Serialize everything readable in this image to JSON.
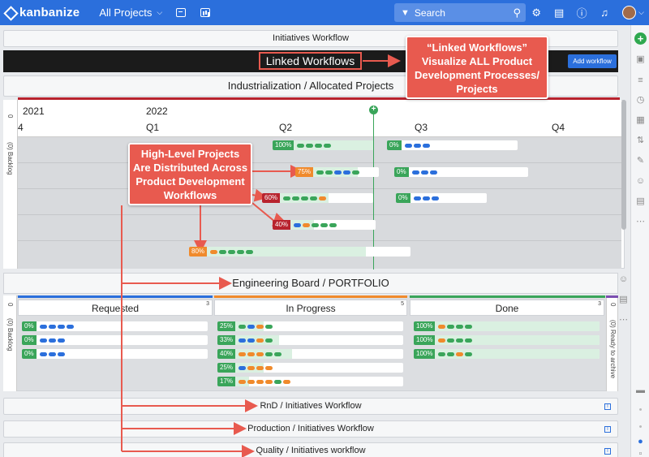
{
  "topbar": {
    "logo": "kanbanize",
    "projects_label": "All Projects",
    "search_placeholder": "Search"
  },
  "workflows": {
    "initiatives": "Initiatives Workflow",
    "linked": "Linked Workflows",
    "add_workflow": "Add workflow",
    "industrialization": "Industrialization / Allocated Projects",
    "engineering": "Engineering Board / PORTFOLIO",
    "rnd": "RnD / Initiatives Workflow",
    "production": "Production / Initiatives Workflow",
    "quality": "Quality / Initiatives workflow"
  },
  "timeline": {
    "years": [
      "2021",
      "2022"
    ],
    "quarters": [
      "4",
      "Q1",
      "Q2",
      "Q3",
      "Q4"
    ],
    "lane_zero": "0",
    "backlog_label": "(0) Backlog",
    "cards": [
      {
        "pct": "100%",
        "color": "#3aa55a",
        "dots": [
          "#3aa55a",
          "#3aa55a",
          "#3aa55a",
          "#3aa55a"
        ],
        "progress": 1.0
      },
      {
        "pct": "0%",
        "color": "#3aa55a",
        "dots": [
          "#2b6fdc",
          "#2b6fdc",
          "#2b6fdc"
        ],
        "progress": 0.0
      },
      {
        "pct": "75%",
        "color": "#f08a2c",
        "dots": [
          "#3aa55a",
          "#3aa55a",
          "#2b6fdc",
          "#2b6fdc",
          "#3aa55a"
        ],
        "progress": 0.75
      },
      {
        "pct": "0%",
        "color": "#3aa55a",
        "dots": [
          "#2b6fdc",
          "#2b6fdc",
          "#2b6fdc"
        ],
        "progress": 0.0
      },
      {
        "pct": "60%",
        "color": "#b8232e",
        "dots": [
          "#3aa55a",
          "#3aa55a",
          "#3aa55a",
          "#3aa55a",
          "#f08a2c"
        ],
        "progress": 0.6
      },
      {
        "pct": "0%",
        "color": "#3aa55a",
        "dots": [
          "#2b6fdc",
          "#2b6fdc",
          "#2b6fdc"
        ],
        "progress": 0.0
      },
      {
        "pct": "40%",
        "color": "#b8232e",
        "dots": [
          "#2b6fdc",
          "#f08a2c",
          "#3aa55a",
          "#3aa55a",
          "#3aa55a"
        ],
        "progress": 0.4
      },
      {
        "pct": "80%",
        "color": "#f08a2c",
        "dots": [
          "#f08a2c",
          "#3aa55a",
          "#3aa55a",
          "#3aa55a",
          "#3aa55a"
        ],
        "progress": 0.8
      }
    ]
  },
  "engineering": {
    "lane_zero": "0",
    "backlog_label": "(0) Backlog",
    "archive_label": "(0) Ready to archive",
    "columns": [
      {
        "name": "Requested",
        "count": "3",
        "color": "#2b6fdc"
      },
      {
        "name": "In Progress",
        "count": "5",
        "color": "#f08a2c"
      },
      {
        "name": "Done",
        "count": "3",
        "color": "#3aa55a"
      }
    ],
    "requested_cards": [
      {
        "pct": "0%",
        "dots": [
          "#2b6fdc",
          "#2b6fdc",
          "#2b6fdc",
          "#2b6fdc"
        ]
      },
      {
        "pct": "0%",
        "dots": [
          "#2b6fdc",
          "#2b6fdc",
          "#2b6fdc"
        ]
      },
      {
        "pct": "0%",
        "dots": [
          "#2b6fdc",
          "#2b6fdc",
          "#2b6fdc"
        ]
      }
    ],
    "progress_cards": [
      {
        "pct": "25%",
        "dots": [
          "#3aa55a",
          "#2b6fdc",
          "#f08a2c",
          "#3aa55a"
        ],
        "progress": 0.25
      },
      {
        "pct": "33%",
        "dots": [
          "#2b6fdc",
          "#2b6fdc",
          "#f08a2c",
          "#3aa55a"
        ],
        "progress": 0.33
      },
      {
        "pct": "40%",
        "dots": [
          "#f08a2c",
          "#f08a2c",
          "#f08a2c",
          "#3aa55a",
          "#3aa55a"
        ],
        "progress": 0.4
      },
      {
        "pct": "25%",
        "dots": [
          "#2b6fdc",
          "#f08a2c",
          "#f08a2c",
          "#f08a2c"
        ],
        "progress": 0.25
      },
      {
        "pct": "17%",
        "dots": [
          "#f08a2c",
          "#f08a2c",
          "#f08a2c",
          "#f08a2c",
          "#3aa55a",
          "#f08a2c"
        ],
        "progress": 0.17
      }
    ],
    "done_cards": [
      {
        "pct": "100%",
        "dots": [
          "#f08a2c",
          "#3aa55a",
          "#3aa55a",
          "#3aa55a"
        ]
      },
      {
        "pct": "100%",
        "dots": [
          "#f08a2c",
          "#3aa55a",
          "#3aa55a",
          "#3aa55a"
        ]
      },
      {
        "pct": "100%",
        "dots": [
          "#3aa55a",
          "#3aa55a",
          "#f08a2c",
          "#3aa55a"
        ]
      }
    ]
  },
  "annotations": {
    "linked_callout": [
      "“Linked Workflows”",
      "Visualize ALL Product",
      "Development Processes/",
      "Projects"
    ],
    "projects_callout": [
      "High-Level Projects",
      "Are Distributed Across",
      "Product Development",
      "Workflows"
    ]
  },
  "colors": {
    "topbar": "#2b6fdc",
    "accent_red": "#e85a4f",
    "green": "#3aa55a",
    "orange": "#f08a2c",
    "blue": "#2b6fdc",
    "dark_red": "#b8232e"
  }
}
